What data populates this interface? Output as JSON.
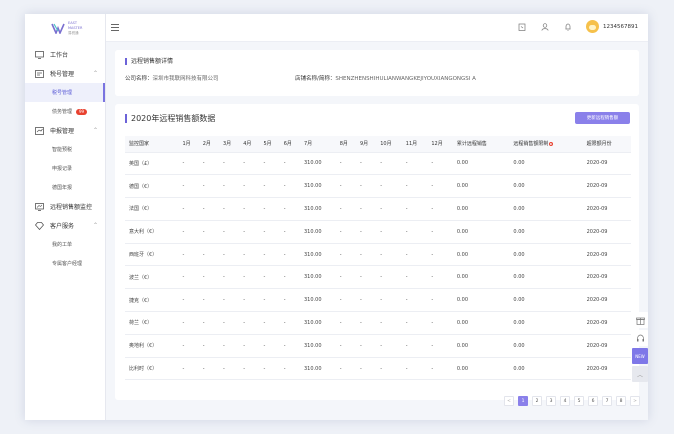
{
  "app": {
    "logo_line1": "EAST",
    "logo_line2": "MASTER",
    "logo_line3": "易税通"
  },
  "sidebar": {
    "items": [
      {
        "label": "工作台",
        "icon": "monitor-icon"
      },
      {
        "label": "税号管理",
        "icon": "id-card-icon",
        "children": [
          {
            "label": "税号管理",
            "active": true
          },
          {
            "label": "债务管理",
            "badge": "99"
          }
        ]
      },
      {
        "label": "申报管理",
        "icon": "report-icon",
        "children": [
          {
            "label": "智能预税"
          },
          {
            "label": "申报记录"
          },
          {
            "label": "德国年报"
          }
        ]
      },
      {
        "label": "远程销售额监控",
        "icon": "monitor-chart-icon"
      },
      {
        "label": "客户服务",
        "icon": "diamond-icon",
        "children": [
          {
            "label": "我的工单"
          },
          {
            "label": "专属客户经理"
          }
        ]
      }
    ]
  },
  "topbar": {
    "user_id": "1234567891"
  },
  "details": {
    "title": "远程销售额详情",
    "company_label": "公司名称：",
    "company_value": "深圳市我联网科技有限公司",
    "store_label": "店铺名称/简称：",
    "store_value": "SHENZHENSHIHULIANWANGKEJIYOUXIANGONGSI A"
  },
  "sales": {
    "title": "2020年远程销售额数据",
    "update_button": "更新远程销售额",
    "headers": [
      "监控国家",
      "1月",
      "2月",
      "3月",
      "4月",
      "5月",
      "6月",
      "7月",
      "8月",
      "9月",
      "10月",
      "11月",
      "12月",
      "累计远程销售",
      "远程销售额限制",
      "超限额月份"
    ],
    "rows": [
      [
        "英国（£）",
        "-",
        "-",
        "-",
        "-",
        "-",
        "-",
        "310.00",
        "-",
        "-",
        "-",
        "-",
        "-",
        "0.00",
        "0.00",
        "2020-09"
      ],
      [
        "德国（€）",
        "-",
        "-",
        "-",
        "-",
        "-",
        "-",
        "310.00",
        "-",
        "-",
        "-",
        "-",
        "-",
        "0.00",
        "0.00",
        "2020-09"
      ],
      [
        "法国（€）",
        "-",
        "-",
        "-",
        "-",
        "-",
        "-",
        "310.00",
        "-",
        "-",
        "-",
        "-",
        "-",
        "0.00",
        "0.00",
        "2020-09"
      ],
      [
        "意大利（€）",
        "-",
        "-",
        "-",
        "-",
        "-",
        "-",
        "310.00",
        "-",
        "-",
        "-",
        "-",
        "-",
        "0.00",
        "0.00",
        "2020-09"
      ],
      [
        "西班牙（€）",
        "-",
        "-",
        "-",
        "-",
        "-",
        "-",
        "310.00",
        "-",
        "-",
        "-",
        "-",
        "-",
        "0.00",
        "0.00",
        "2020-09"
      ],
      [
        "波兰（€）",
        "-",
        "-",
        "-",
        "-",
        "-",
        "-",
        "310.00",
        "-",
        "-",
        "-",
        "-",
        "-",
        "0.00",
        "0.00",
        "2020-09"
      ],
      [
        "捷克（€）",
        "-",
        "-",
        "-",
        "-",
        "-",
        "-",
        "310.00",
        "-",
        "-",
        "-",
        "-",
        "-",
        "0.00",
        "0.00",
        "2020-09"
      ],
      [
        "荷兰（€）",
        "-",
        "-",
        "-",
        "-",
        "-",
        "-",
        "310.00",
        "-",
        "-",
        "-",
        "-",
        "-",
        "0.00",
        "0.00",
        "2020-09"
      ],
      [
        "奥地利（€）",
        "-",
        "-",
        "-",
        "-",
        "-",
        "-",
        "310.00",
        "-",
        "-",
        "-",
        "-",
        "-",
        "0.00",
        "0.00",
        "2020-09"
      ],
      [
        "比利时（€）",
        "-",
        "-",
        "-",
        "-",
        "-",
        "-",
        "310.00",
        "-",
        "-",
        "-",
        "-",
        "-",
        "0.00",
        "0.00",
        "2020-09"
      ]
    ]
  },
  "pagination": {
    "prev": "<",
    "next": ">",
    "pages": [
      "1",
      "2",
      "3",
      "4",
      "5",
      "6",
      "7",
      "8"
    ],
    "current": "1"
  },
  "float_bar": {
    "new_label": "NEW"
  },
  "colors": {
    "accent": "#8a80ea",
    "badge": "#e8412f"
  }
}
